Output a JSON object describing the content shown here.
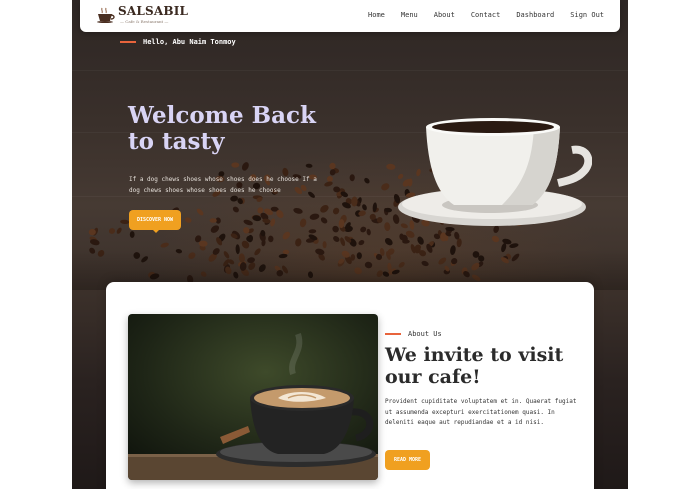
{
  "brand": {
    "name": "SALSABIL",
    "tagline": "— Cafe & Restaurant —",
    "logo_icon": "coffee-cup-icon"
  },
  "nav": {
    "links": [
      "Home",
      "Menu",
      "About",
      "Contact",
      "Dashboard",
      "Sign Out"
    ]
  },
  "hero": {
    "greeting": "Hello, Abu Naim Tonmoy",
    "title": "Welcome Back to tasty",
    "description": "If a dog chews shoes whose shoes does he choose If a dog chews shoes whose shoes does he choose",
    "button": "DISCOVER NOW"
  },
  "about": {
    "label": "About Us",
    "title": "We invite to visit our cafe!",
    "description": "Provident cupiditate voluptatem et in. Quaerat fugiat ut assumenda excepturi exercitationem quasi. In deleniti eaque aut repudiandae et a id nisi.",
    "button": "READ MORE"
  },
  "colors": {
    "accent": "#f0a020",
    "line_accent": "#e8643c",
    "hero_title": "#d9d4f5"
  }
}
